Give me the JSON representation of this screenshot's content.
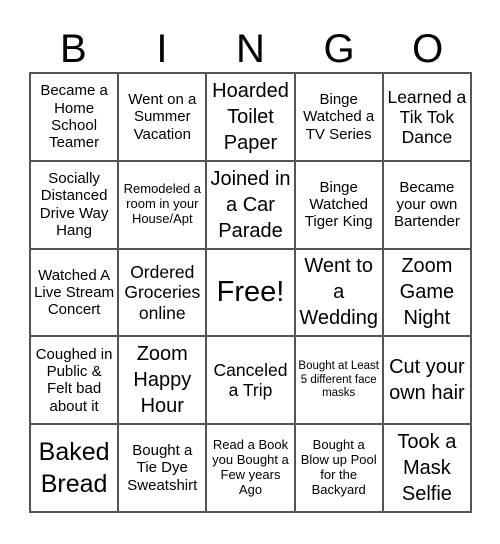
{
  "header": [
    "B",
    "I",
    "N",
    "G",
    "O"
  ],
  "cells": [
    "Became a Home School Teamer",
    "Went on a Summer Vacation",
    "Hoarded Toilet Paper",
    "Binge Watched a TV Series",
    "Learned a Tik Tok Dance",
    "Socially Distanced Drive Way Hang",
    "Remodeled a room in your House/Apt",
    "Joined in a Car Parade",
    "Binge Watched Tiger King",
    "Became your own Bartender",
    "Watched A Live Stream Concert",
    "Ordered Groceries online",
    "Free!",
    "Went to a Wedding",
    "Zoom Game Night",
    "Coughed in Public & Felt bad about it",
    "Zoom Happy Hour",
    "Canceled a Trip",
    "Bought at Least 5 different face masks",
    "Cut your own hair",
    "Baked Bread",
    "Bought a Tie Dye Sweatshirt",
    "Read a Book you Bought a Few years Ago",
    "Bought a Blow up Pool for the Backyard",
    "Took a Mask Selfie"
  ]
}
